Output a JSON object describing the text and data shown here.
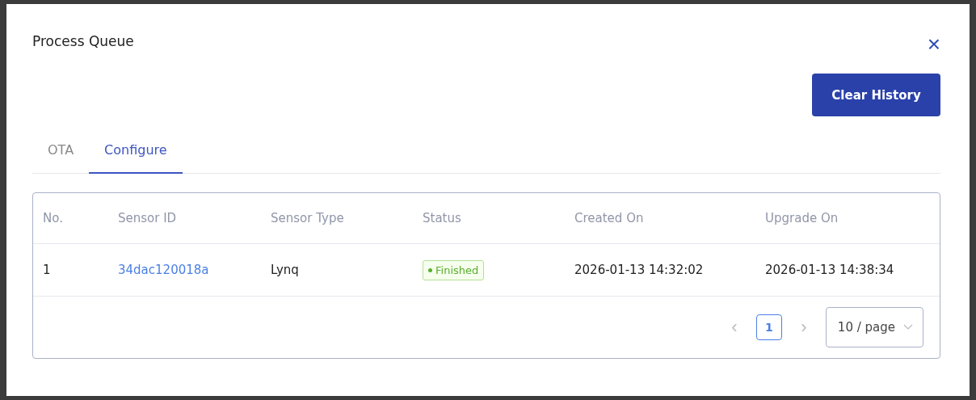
{
  "dialog": {
    "title": "Process Queue",
    "close": "×",
    "action": "Clear History"
  },
  "tabs": [
    {
      "label": "OTA",
      "selected": false
    },
    {
      "label": "Configure",
      "selected": true
    }
  ],
  "table": {
    "columns": [
      "No.",
      "Sensor ID",
      "Sensor Type",
      "Status",
      "Created On",
      "Upgrade On"
    ],
    "rows": [
      {
        "no": "1",
        "sensor_id": "34dac120018a",
        "sensor_type": "Lynq",
        "status": {
          "text": "Finished",
          "kind": "success"
        },
        "created_on": "2026-01-13 14:32:02",
        "upgrade_on": "2026-01-13 14:38:34"
      }
    ]
  },
  "pagination": {
    "prev": "‹",
    "pages": [
      {
        "label": "1",
        "selected": true
      }
    ],
    "next": "›",
    "page_size": "10 / page"
  }
}
